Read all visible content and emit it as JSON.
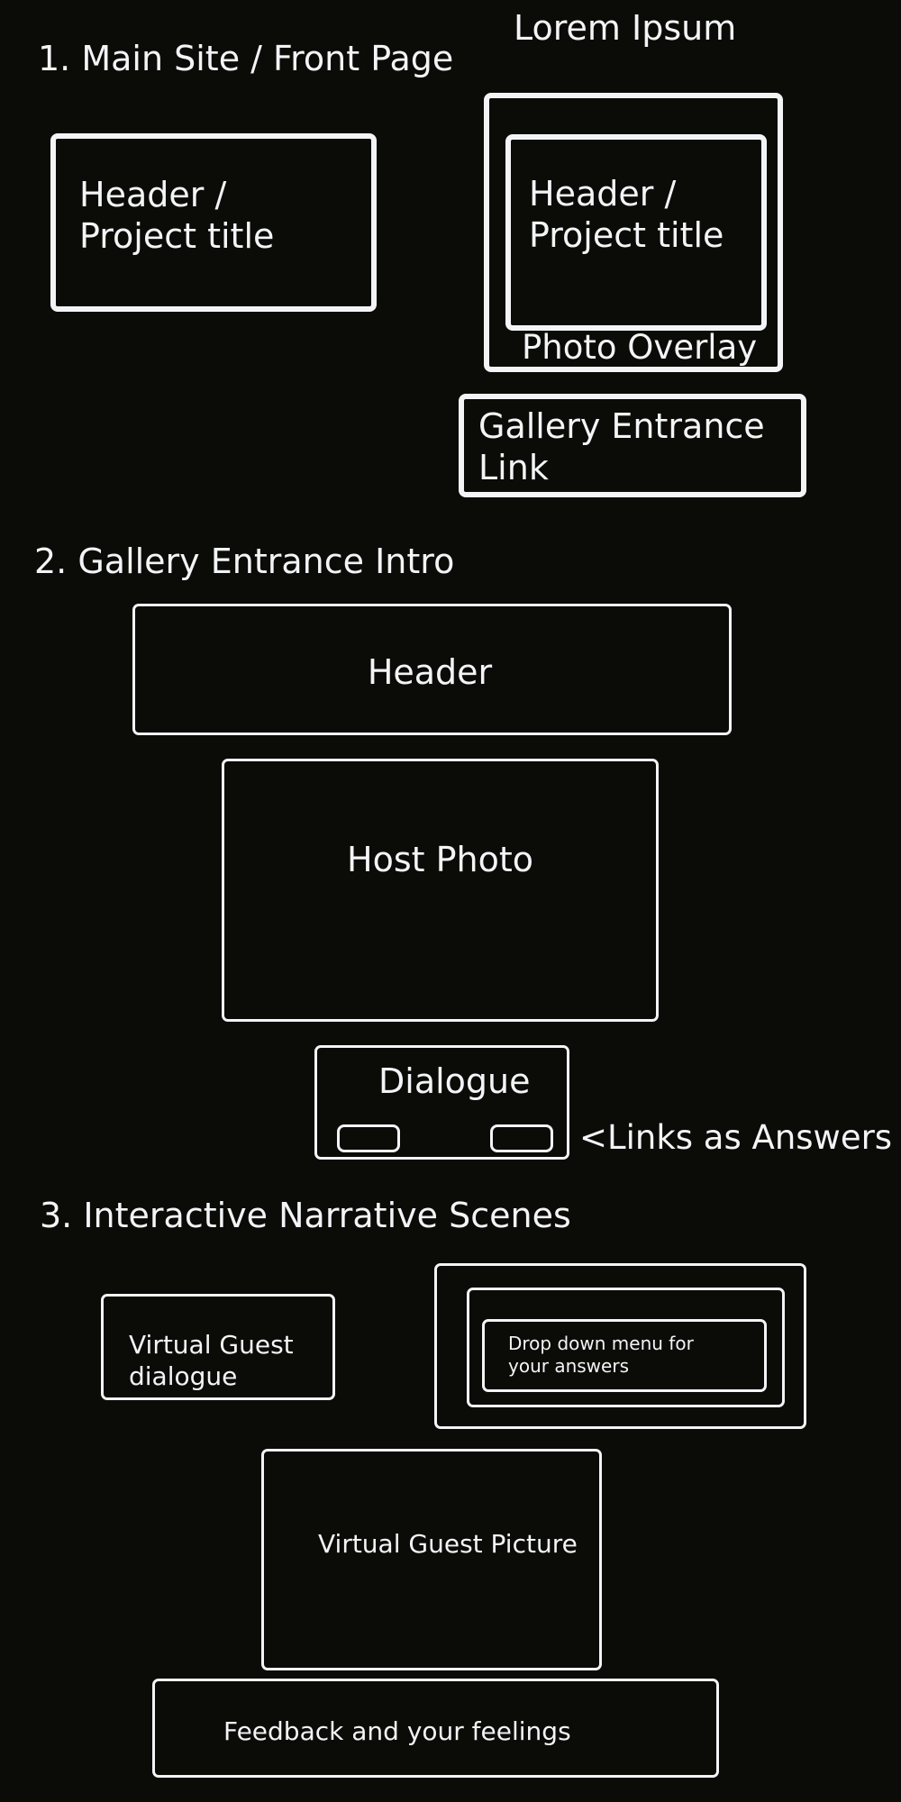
{
  "section1": {
    "heading": "1.  Main Site / Front Page",
    "top_right_label": "Lorem Ipsum",
    "left_box_label": "Header /\nProject title",
    "inner_box_label": "Header /\nProject title",
    "photo_overlay_label": "Photo Overlay",
    "gallery_link_label": "Gallery Entrance\nLink"
  },
  "section2": {
    "heading": "2.  Gallery Entrance Intro",
    "header_label": "Header",
    "host_photo_label": "Host Photo",
    "dialogue_label": "Dialogue",
    "links_annotation": "<Links as Answers"
  },
  "section3": {
    "heading": "3. Interactive Narrative Scenes",
    "guest_dialogue_label": "Virtual Guest\ndialogue",
    "dropdown_label": "Drop down menu for\nyour answers",
    "guest_picture_label": "Virtual Guest Picture",
    "feedback_label": "Feedback and your feelings"
  }
}
